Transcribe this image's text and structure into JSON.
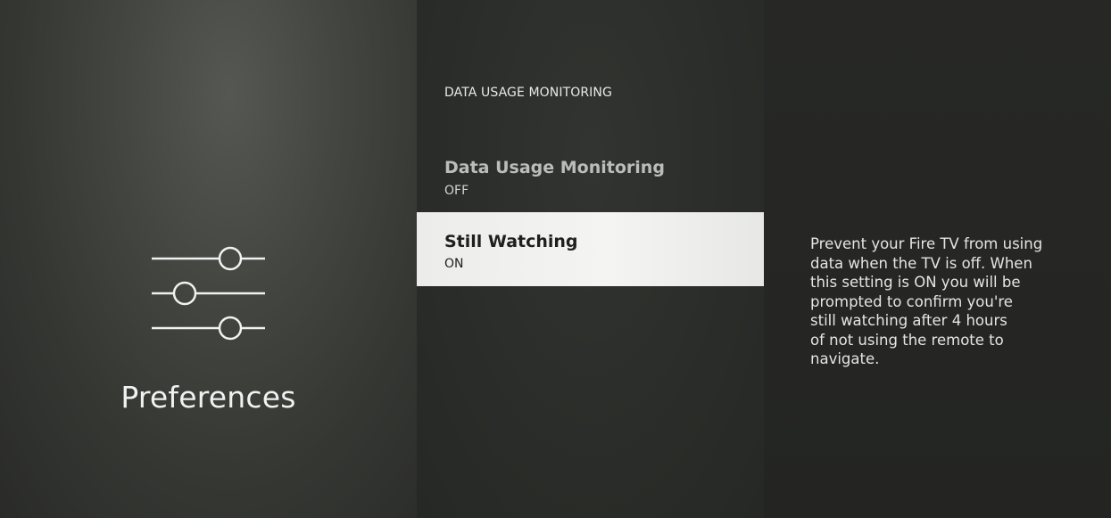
{
  "left_panel": {
    "icon": "preferences-sliders-icon",
    "title": "Preferences"
  },
  "middle_panel": {
    "section_header": "DATA USAGE MONITORING",
    "items": [
      {
        "label": "Data Usage Monitoring",
        "value": "OFF",
        "selected": false
      },
      {
        "label": "Still Watching",
        "value": "ON",
        "selected": true
      }
    ]
  },
  "right_panel": {
    "description": "Prevent your Fire TV from using\ndata when the TV is off. When\nthis setting is ON you will be\nprompted to confirm you're\nstill watching after 4 hours\nof not using the remote to\nnavigate."
  },
  "colors": {
    "selected_bg": "#f0f0ef",
    "text_light": "#f1f1f1",
    "text_dark": "#1f1f1f"
  }
}
